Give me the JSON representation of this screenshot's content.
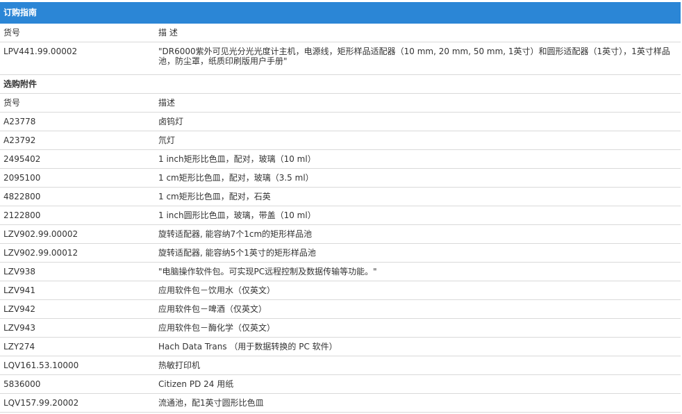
{
  "banner_title": "订购指南",
  "main_header": {
    "code": "货号",
    "desc": "描 述"
  },
  "main_item": {
    "code": "LPV441.99.00002",
    "desc": "\"DR6000紫外可见光分光光度计主机，电源线，矩形样品适配器（10 mm, 20 mm, 50 mm, 1英寸）和圆形适配器（1英寸），1英寸样品池，防尘罩，纸质印刷版用户手册\""
  },
  "accessories_title": "选购附件",
  "accessories_header": {
    "code": "货号",
    "desc": "描述"
  },
  "accessories": [
    {
      "code": "A23778",
      "desc": "卤钨灯"
    },
    {
      "code": "A23792",
      "desc": "氘灯"
    },
    {
      "code": "2495402",
      "desc": "1 inch矩形比色皿，配对，玻璃（10 ml）"
    },
    {
      "code": "2095100",
      "desc": "1 cm矩形比色皿，配对，玻璃（3.5 ml）"
    },
    {
      "code": "4822800",
      "desc": "1 cm矩形比色皿，配对，石英"
    },
    {
      "code": "2122800",
      "desc": "1 inch圆形比色皿，玻璃，带盖（10 ml）"
    },
    {
      "code": "LZV902.99.00002",
      "desc": "旋转适配器, 能容纳7个1cm的矩形样品池"
    },
    {
      "code": "LZV902.99.00012",
      "desc": "旋转适配器, 能容纳5个1英寸的矩形样品池"
    },
    {
      "code": "LZV938",
      "desc": "\"电脑操作软件包。可实现PC远程控制及数据传输等功能。\""
    },
    {
      "code": "LZV941",
      "desc": "应用软件包－饮用水（仅英文）"
    },
    {
      "code": "LZV942",
      "desc": "应用软件包－啤酒（仅英文）"
    },
    {
      "code": "LZV943",
      "desc": "应用软件包－酶化学（仅英文）"
    },
    {
      "code": "LZY274",
      "desc": "Hach Data Trans （用于数据转换的 PC 软件）"
    },
    {
      "code": "LQV161.53.10000",
      "desc": "热敏打印机"
    },
    {
      "code": "5836000",
      "desc": "Citizen PD 24 用纸"
    },
    {
      "code": "LQV157.99.20002",
      "desc": "流通池，配1英寸圆形比色皿"
    }
  ]
}
